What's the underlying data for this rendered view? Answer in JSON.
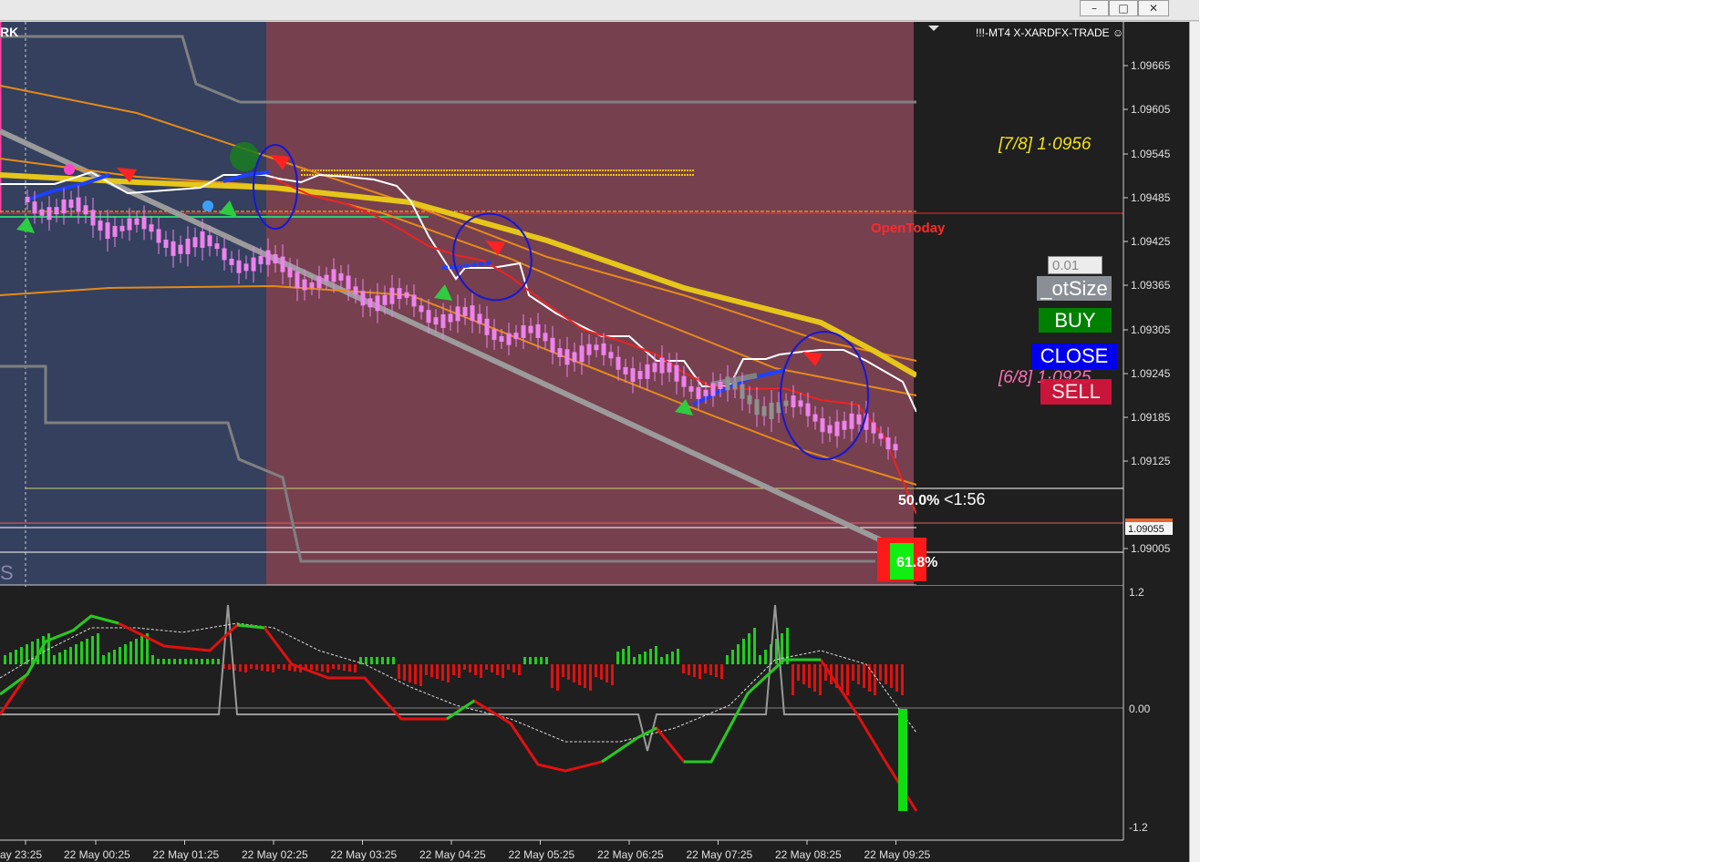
{
  "window": {
    "minimize_glyph": "–",
    "maximize_glyph": "□",
    "close_glyph": "✕"
  },
  "indicator_header": "!!!-MT4 X-XARDFX-TRADE ☺",
  "corner_label": "RK",
  "watermark_letter": "S",
  "murrey_levels": {
    "upper": "[7/8] 1·0956",
    "lower": "[6/8] 1·0925"
  },
  "open_today_label": "OpenToday",
  "fib_labels": {
    "fifty": "50.0%",
    "sixtyone": "61.8%"
  },
  "bar_timer": "<1:56",
  "controls": {
    "lot_value": "0.01",
    "lotsize_label": "_otSize",
    "buy_label": "BUY",
    "close_label": "CLOSE",
    "sell_label": "SELL"
  },
  "price_axis": [
    "1.09665",
    "1.09605",
    "1.09545",
    "1.09485",
    "1.09425",
    "1.09365",
    "1.09305",
    "1.09245",
    "1.09185",
    "1.09125",
    "1.09055",
    "1.09005"
  ],
  "current_price": "1.09055",
  "osc_axis": [
    "1.2",
    "0.00",
    "-1.2"
  ],
  "time_axis": [
    "ay 23:25",
    "22 May 00:25",
    "22 May 01:25",
    "22 May 02:25",
    "22 May 03:25",
    "22 May 04:25",
    "22 May 05:25",
    "22 May 06:25",
    "22 May 07:25",
    "22 May 08:25",
    "22 May 09:25"
  ],
  "colors": {
    "background": "#1f1f1f",
    "session_blue": "#34405e",
    "session_red": "#76404f",
    "candle": "#ee82ee",
    "ema_gold": "#e6c619",
    "bands_orange": "#e58a1a",
    "buy_green": "#008000",
    "close_blue": "#0000ff",
    "sell_red": "#dc143c",
    "osc_green": "#22cc22",
    "osc_red": "#e01010"
  }
}
